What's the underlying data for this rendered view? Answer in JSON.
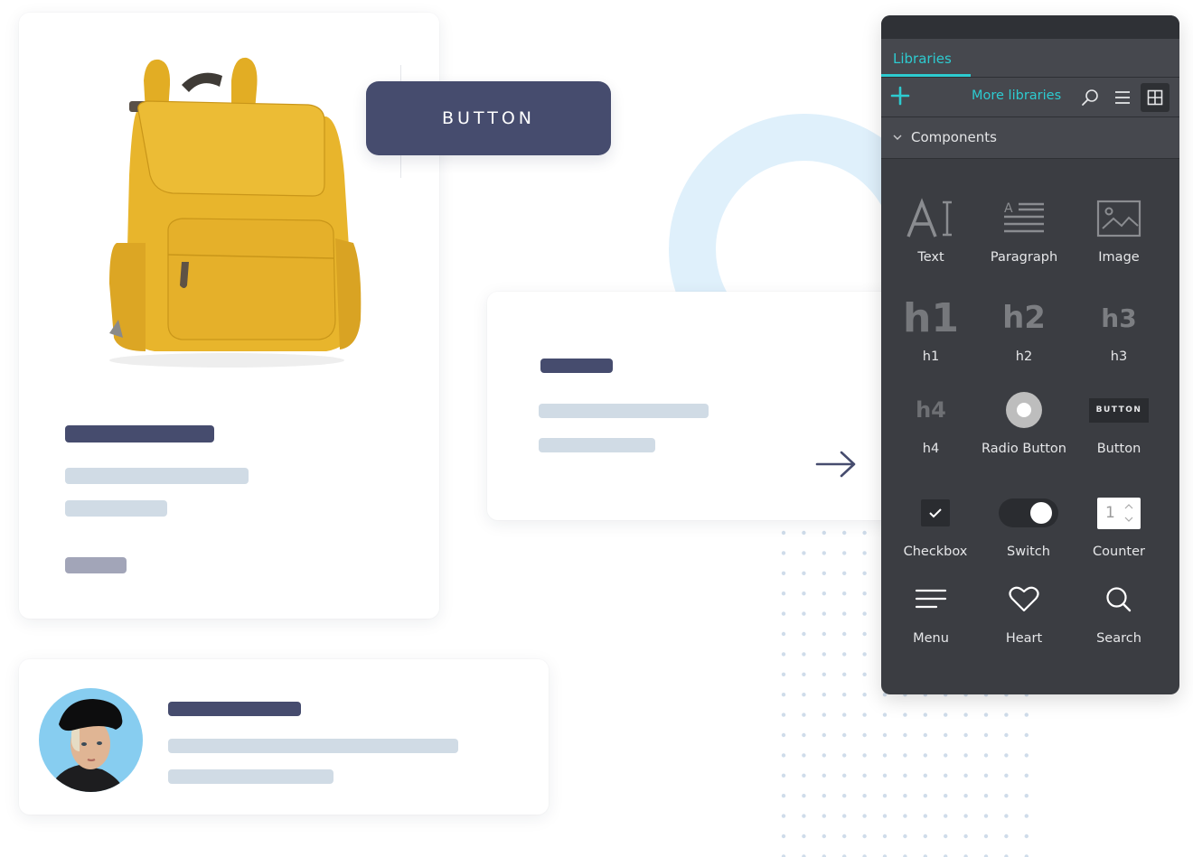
{
  "floating_button": {
    "label": "BUTTON"
  },
  "libraries_panel": {
    "tab": "Libraries",
    "toolbar": {
      "add_icon": "plus-icon",
      "more_libraries_label": "More libraries",
      "search_icon": "search-icon",
      "list_view_icon": "list-icon",
      "grid_view_icon": "grid-icon",
      "active_view": "grid"
    },
    "section": {
      "title": "Components",
      "expanded": true
    },
    "components": [
      {
        "label": "Text",
        "icon": "text-icon",
        "glyph": "AI"
      },
      {
        "label": "Paragraph",
        "icon": "paragraph-icon"
      },
      {
        "label": "Image",
        "icon": "image-icon"
      },
      {
        "label": "h1",
        "icon": "h1-icon",
        "glyph": "h1"
      },
      {
        "label": "h2",
        "icon": "h2-icon",
        "glyph": "h2"
      },
      {
        "label": "h3",
        "icon": "h3-icon",
        "glyph": "h3"
      },
      {
        "label": "h4",
        "icon": "h4-icon",
        "glyph": "h4"
      },
      {
        "label": "Radio Button",
        "icon": "radio-button-icon"
      },
      {
        "label": "Button",
        "icon": "button-icon",
        "glyph": "BUTTON"
      },
      {
        "label": "Checkbox",
        "icon": "checkbox-icon",
        "checked": true
      },
      {
        "label": "Switch",
        "icon": "switch-icon",
        "on": true
      },
      {
        "label": "Counter",
        "icon": "counter-icon",
        "value": "1"
      },
      {
        "label": "Menu",
        "icon": "menu-icon"
      },
      {
        "label": "Heart",
        "icon": "heart-icon"
      },
      {
        "label": "Search",
        "icon": "search-icon"
      }
    ]
  },
  "colors": {
    "accent": "#2dcbd0",
    "primary_navy": "#464c6e",
    "placeholder_light": "#d0dbe5",
    "placeholder_muted": "#a2a5b8",
    "panel_bg": "#3b3d42",
    "ring": "#dff0fb",
    "backpack": "#e8b52c",
    "avatar_bg": "#87cdf0"
  }
}
